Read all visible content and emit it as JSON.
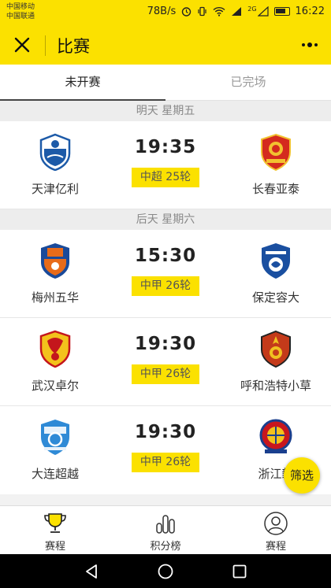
{
  "status_bar": {
    "carriers": [
      "中国移动",
      "中国联通"
    ],
    "speed": "78B/s",
    "network": "2G",
    "time": "16:22"
  },
  "header": {
    "title": "比赛",
    "close_icon": "close-icon",
    "more_icon": "more-icon"
  },
  "tabs": [
    {
      "label": "未开赛",
      "active": true
    },
    {
      "label": "已完场",
      "active": false
    }
  ],
  "days": [
    {
      "label": "明天 星期五",
      "matches": [
        {
          "home": "天津亿利",
          "away": "长春亚泰",
          "time": "19:35",
          "round": "中超 25轮"
        }
      ]
    },
    {
      "label": "后天 星期六",
      "matches": [
        {
          "home": "梅州五华",
          "away": "保定容大",
          "time": "15:30",
          "round": "中甲 26轮"
        },
        {
          "home": "武汉卓尔",
          "away": "呼和浩特小草",
          "time": "19:30",
          "round": "中甲 26轮"
        },
        {
          "home": "大连超越",
          "away": "浙江毅",
          "time": "19:30",
          "round": "中甲 26轮"
        }
      ]
    }
  ],
  "fab": {
    "label": "筛选"
  },
  "bottom_tabs": [
    {
      "label": "赛程",
      "icon": "trophy-icon"
    },
    {
      "label": "积分榜",
      "icon": "bar-chart-icon"
    },
    {
      "label": "赛程",
      "icon": "profile-icon"
    }
  ],
  "colors": {
    "accent": "#fbe100",
    "text": "#222222",
    "muted": "#999999"
  }
}
